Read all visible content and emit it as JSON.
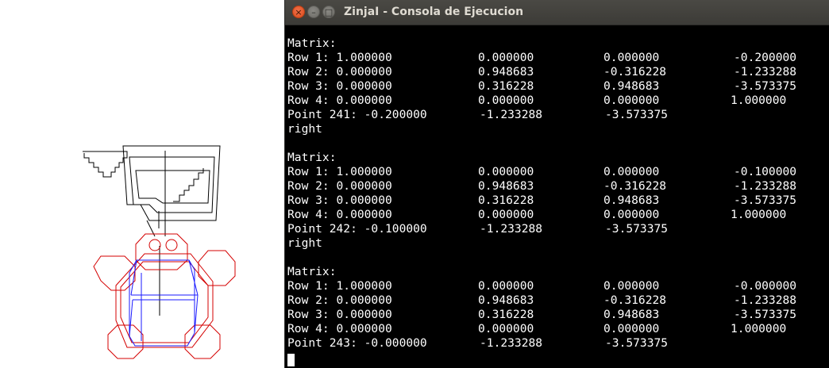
{
  "window": {
    "title": "ZinjaI - Consola de Ejecucion",
    "close_glyph": "×",
    "minimize_glyph": "–",
    "maximize_glyph": "□"
  },
  "console": {
    "blocks": [
      {
        "header": "Matrix:",
        "rows": [
          [
            "Row 1: 1.000000",
            "0.000000",
            "0.000000",
            "-0.200000"
          ],
          [
            "Row 2: 0.000000",
            "0.948683",
            "-0.316228",
            "-1.233288"
          ],
          [
            "Row 3: 0.000000",
            "0.316228",
            "0.948683",
            "-3.573375"
          ],
          [
            "Row 4: 0.000000",
            "0.000000",
            "0.000000",
            "1.000000"
          ]
        ],
        "point": [
          "Point 241: -0.200000",
          "-1.233288",
          "-3.573375"
        ],
        "tail": "right"
      },
      {
        "header": "Matrix:",
        "rows": [
          [
            "Row 1: 1.000000",
            "0.000000",
            "0.000000",
            "-0.100000"
          ],
          [
            "Row 2: 0.000000",
            "0.948683",
            "-0.316228",
            "-1.233288"
          ],
          [
            "Row 3: 0.000000",
            "0.316228",
            "0.948683",
            "-3.573375"
          ],
          [
            "Row 4: 0.000000",
            "0.000000",
            "0.000000",
            "1.000000"
          ]
        ],
        "point": [
          "Point 242: -0.100000",
          "-1.233288",
          "-3.573375"
        ],
        "tail": "right"
      },
      {
        "header": "Matrix:",
        "rows": [
          [
            "Row 1: 1.000000",
            "0.000000",
            "0.000000",
            "-0.000000"
          ],
          [
            "Row 2: 0.000000",
            "0.948683",
            "-0.316228",
            "-1.233288"
          ],
          [
            "Row 3: 0.000000",
            "0.316228",
            "0.948683",
            "-3.573375"
          ],
          [
            "Row 4: 0.000000",
            "0.000000",
            "0.000000",
            "1.000000"
          ]
        ],
        "point": [
          "Point 243: -0.000000",
          "-1.233288",
          "-3.573375"
        ],
        "tail": ""
      }
    ]
  },
  "colors": {
    "terminal_bg": "#000000",
    "terminal_fg": "#ffffff",
    "titlebar": "#3c3b37",
    "close_button": "#e95420",
    "model_black": "#000000",
    "model_red": "#d40000",
    "model_blue": "#1a1aff"
  }
}
